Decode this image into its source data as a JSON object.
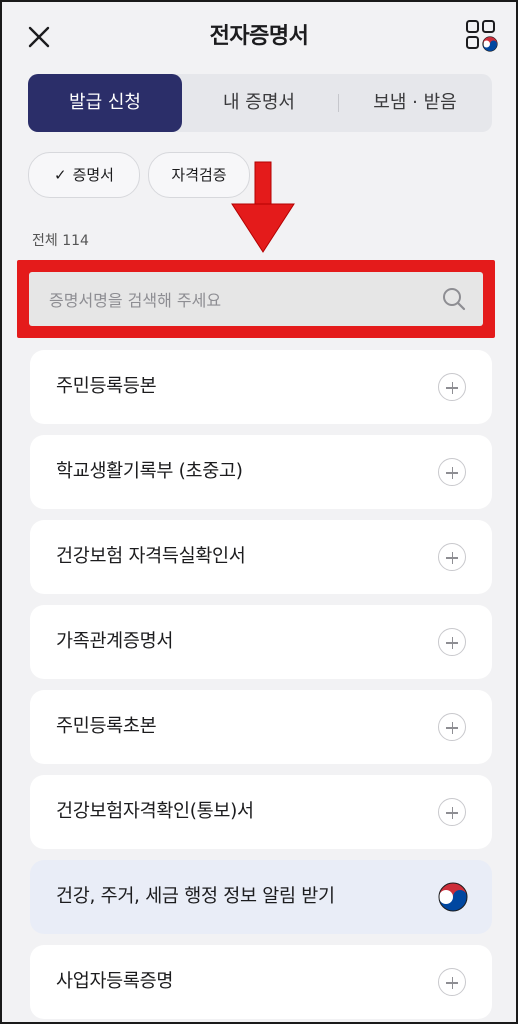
{
  "header": {
    "title": "전자증명서",
    "close_icon": "close-icon",
    "menu_icon": "app-menu-icon"
  },
  "tabs": [
    {
      "label": "발급 신청",
      "active": true
    },
    {
      "label": "내 증명서",
      "active": false
    },
    {
      "label": "보냄 · 받음",
      "active": false
    }
  ],
  "filters": [
    {
      "label": "증명서",
      "selected": true,
      "icon": "check-icon"
    },
    {
      "label": "자격검증",
      "selected": false
    }
  ],
  "count_label": "전체 114",
  "search": {
    "placeholder": "증명서명을 검색해 주세요",
    "icon": "search-icon"
  },
  "list": [
    {
      "label": "주민등록등본",
      "action_icon": "plus-icon"
    },
    {
      "label": "학교생활기록부 (초중고)",
      "action_icon": "plus-icon"
    },
    {
      "label": "건강보험 자격득실확인서",
      "action_icon": "plus-icon"
    },
    {
      "label": "가족관계증명서",
      "action_icon": "plus-icon"
    },
    {
      "label": "주민등록초본",
      "action_icon": "plus-icon"
    },
    {
      "label": "건강보험자격확인(통보)서",
      "action_icon": "plus-icon"
    },
    {
      "label": "건강, 주거, 세금 행정 정보 알림 받기",
      "action_icon": "korea-emblem-icon"
    },
    {
      "label": "사업자등록증명",
      "action_icon": "plus-icon"
    }
  ],
  "colors": {
    "accent": "#2b2e69",
    "highlight_box": "#e41b1b",
    "highlight_row": "#e9edf7"
  }
}
